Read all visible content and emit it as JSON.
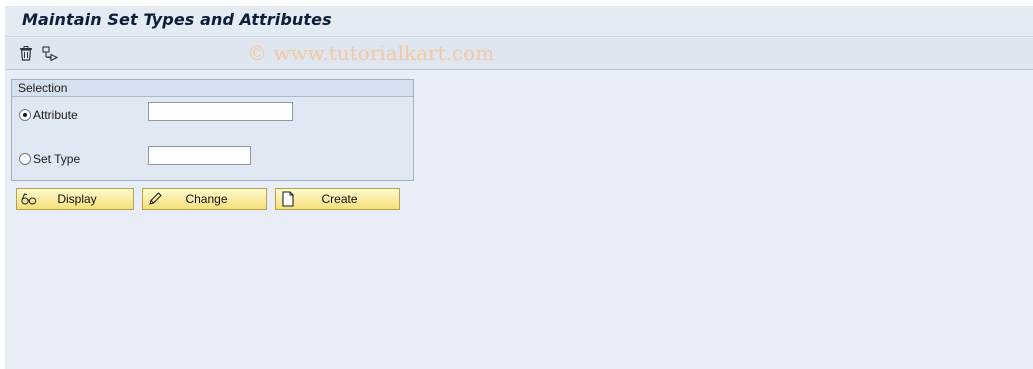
{
  "window": {
    "title": "Maintain Set Types and Attributes"
  },
  "toolbar": {
    "items": [
      {
        "name": "delete",
        "icon": "trash-icon"
      },
      {
        "name": "navigate",
        "icon": "other-object-icon"
      }
    ],
    "watermark": "© www.tutorialkart.com"
  },
  "selection": {
    "header": "Selection",
    "options": [
      {
        "label": "Attribute",
        "checked": true,
        "value": ""
      },
      {
        "label": "Set Type",
        "checked": false,
        "value": ""
      }
    ]
  },
  "buttons": {
    "display": "Display",
    "change": "Change",
    "create": "Create"
  },
  "colors": {
    "background": "#e9eef6",
    "button_fill": "#f4e07a",
    "watermark": "#f2c9a3",
    "title": "#0c1f3a"
  }
}
